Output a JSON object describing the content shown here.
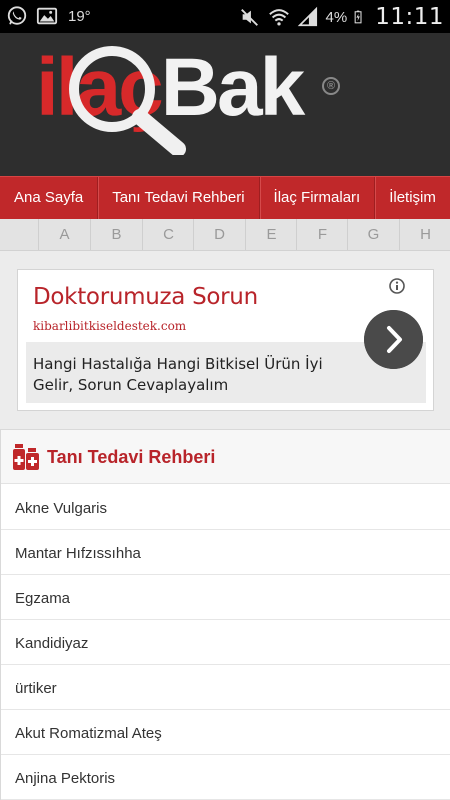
{
  "status_bar": {
    "temperature": "19°",
    "battery_percent": "4%",
    "time": "11:11"
  },
  "header": {
    "logo_text_red": "ilaç",
    "logo_text_white": "Bak",
    "logo_reg_mark": "®"
  },
  "nav": {
    "items": [
      {
        "label": "Ana Sayfa"
      },
      {
        "label": "Tanı Tedavi Rehberi"
      },
      {
        "label": "İlaç Firmaları"
      },
      {
        "label": "İletişim"
      }
    ]
  },
  "alphabet": {
    "letters": [
      "A",
      "B",
      "C",
      "D",
      "E",
      "F",
      "G",
      "H"
    ]
  },
  "ad": {
    "title": "Doktorumuza Sorun",
    "url": "kibarlibitkiseldestek.com",
    "description": "Hangi Hastalığa Hangi Bitkisel Ürün İyi Gelir, Sorun Cevaplayalım"
  },
  "section": {
    "title": "Tanı Tedavi Rehberi",
    "items": [
      {
        "label": "Akne Vulgaris"
      },
      {
        "label": "Mantar Hıfzıssıhha"
      },
      {
        "label": "Egzama"
      },
      {
        "label": "Kandidiyaz"
      },
      {
        "label": "ürtiker"
      },
      {
        "label": "Akut Romatizmal Ateş"
      },
      {
        "label": "Anjina Pektoris"
      }
    ]
  },
  "colors": {
    "brand_red": "#c0282a",
    "header_dark": "#2e2e2e",
    "ad_red": "#b8242a"
  }
}
